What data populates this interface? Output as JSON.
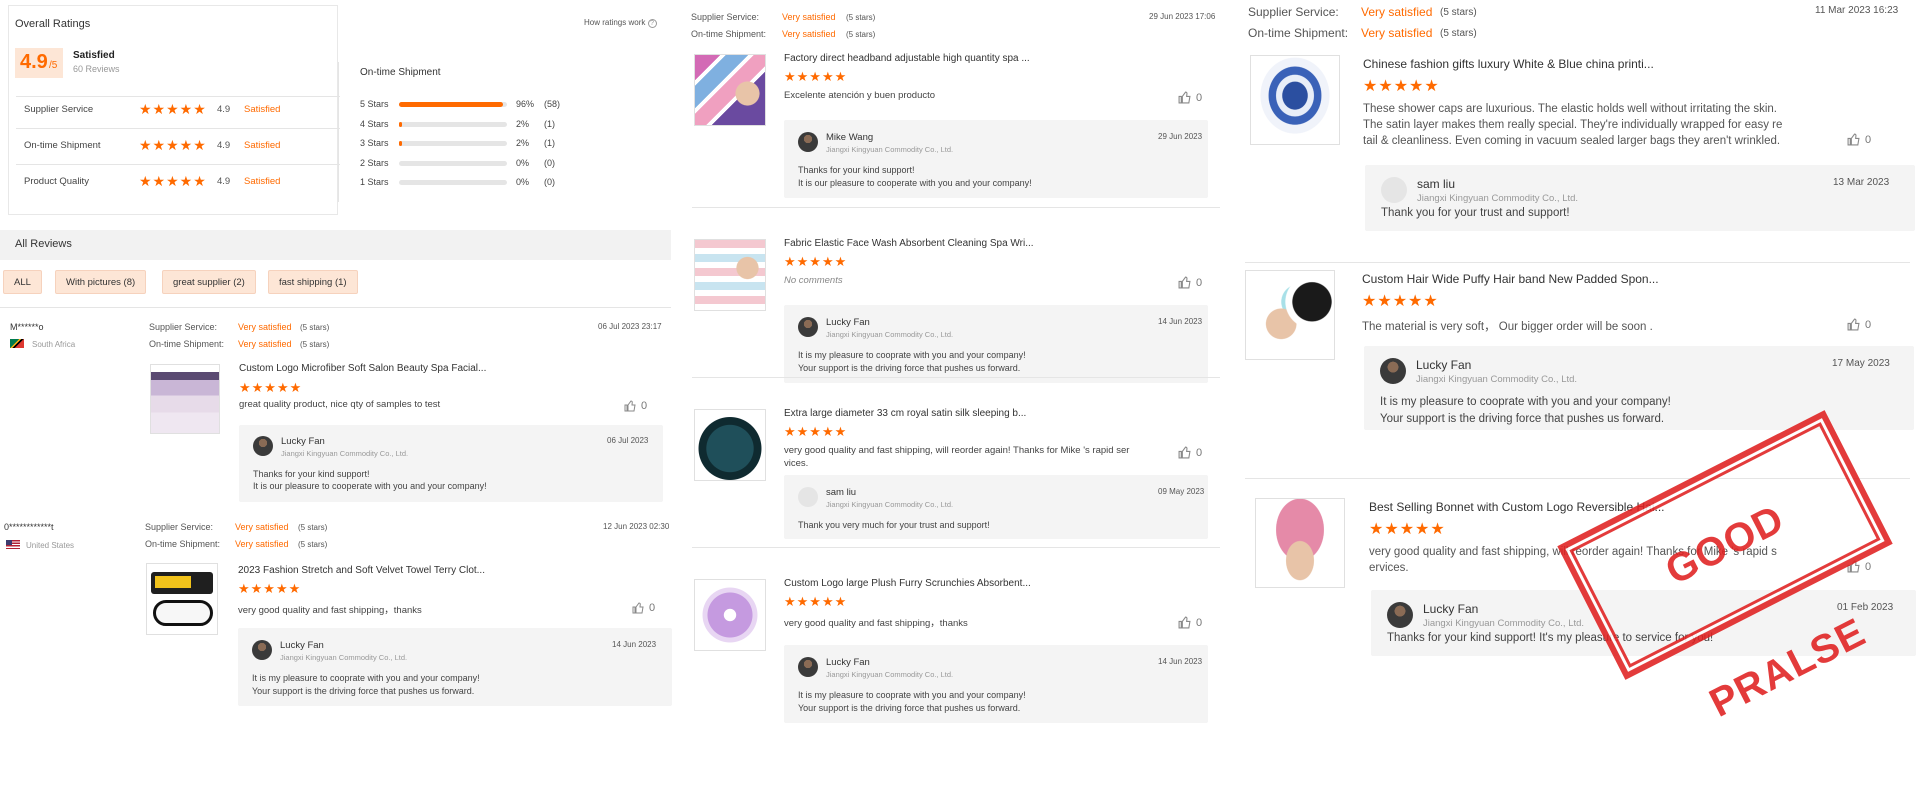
{
  "overall": {
    "header": "Overall Ratings",
    "how": "How ratings work",
    "score": "4.9",
    "out_of": "/5",
    "label": "Satisfied",
    "reviews": "60 Reviews"
  },
  "categories": [
    {
      "name": "Supplier Service",
      "score": "4.9",
      "label": "Satisfied"
    },
    {
      "name": "On-time Shipment",
      "score": "4.9",
      "label": "Satisfied"
    },
    {
      "name": "Product Quality",
      "score": "4.9",
      "label": "Satisfied"
    }
  ],
  "shipment": {
    "title": "On-time Shipment",
    "rows": [
      {
        "label": "5 Stars",
        "pct": "96%",
        "count": "(58)",
        "fill": 0.96
      },
      {
        "label": "4 Stars",
        "pct": "2%",
        "count": "(1)",
        "fill": 0.02
      },
      {
        "label": "3 Stars",
        "pct": "2%",
        "count": "(1)",
        "fill": 0.02
      },
      {
        "label": "2 Stars",
        "pct": "0%",
        "count": "(0)",
        "fill": 0
      },
      {
        "label": "1 Stars",
        "pct": "0%",
        "count": "(0)",
        "fill": 0
      }
    ]
  },
  "all_reviews": {
    "title": "All Reviews",
    "filters": [
      "ALL",
      "With pictures (8)",
      "great supplier (2)",
      "fast shipping (1)"
    ]
  },
  "labels": {
    "supplier_service": "Supplier Service:",
    "ontime": "On-time Shipment:",
    "very_satisfied": "Very satisfied",
    "five_stars": "(5 stars)",
    "stars": "★★★★★",
    "company": "Jiangxi Kingyuan Commodity Co., Ltd."
  },
  "p1": [
    {
      "user": "M******o",
      "country": "South Africa",
      "date": "06 Jul 2023 23:17",
      "product": "Custom Logo Microfiber Soft Salon Beauty Spa Facial...",
      "comment": "great quality product, nice qty of samples to test",
      "likes": "0",
      "reply_name": "Lucky Fan",
      "reply_date": "06 Jul 2023",
      "reply_lines": [
        "Thanks for your kind support!",
        "It is our pleasure to cooperate with you and your company!"
      ]
    },
    {
      "user": "0************t",
      "country": "United States",
      "date": "12 Jun 2023 02:30",
      "product": "2023 Fashion Stretch and Soft Velvet Towel Terry Clot...",
      "comment": "very good quality and fast shipping，thanks",
      "likes": "0",
      "reply_name": "Lucky Fan",
      "reply_date": "14 Jun 2023",
      "reply_lines": [
        "It is my pleasure to cooprate with you and your company!",
        "Your support is the driving force that pushes us forward."
      ]
    }
  ],
  "p2_header": {
    "date": "29 Jun 2023 17:06"
  },
  "p2": [
    {
      "product": "Factory direct headband adjustable high quantity spa ...",
      "comment": "Excelente atención y buen producto",
      "likes": "0",
      "reply_name": "Mike Wang",
      "reply_date": "29 Jun 2023",
      "reply_lines": [
        "Thanks for your kind support!",
        "It is our pleasure to cooperate with you and your company!"
      ]
    },
    {
      "product": "Fabric Elastic Face Wash Absorbent Cleaning Spa Wri...",
      "comment": "No comments",
      "likes": "0",
      "reply_name": "Lucky Fan",
      "reply_date": "14 Jun 2023",
      "reply_lines": [
        "It is my pleasure to cooprate with you and your company!",
        "Your support is the driving force that pushes us forward."
      ]
    },
    {
      "product": "Extra large diameter 33 cm royal satin silk sleeping b...",
      "comment": "very good quality and fast shipping, will reorder again! Thanks for Mike 's rapid ser",
      "comment2": "vices.",
      "likes": "0",
      "reply_name": "sam liu",
      "reply_date": "09 May 2023",
      "reply_lines": [
        "Thank you very much for your trust and support!"
      ]
    },
    {
      "product": "Custom Logo large Plush Furry Scrunchies Absorbent...",
      "comment": "very good quality and fast shipping，thanks",
      "likes": "0",
      "reply_name": "Lucky Fan",
      "reply_date": "14 Jun 2023",
      "reply_lines": [
        "It is my pleasure to cooprate with you and your company!",
        "Your support is the driving force that pushes us forward."
      ]
    }
  ],
  "p3_header": {
    "date": "11 Mar 2023 16:23"
  },
  "p3": [
    {
      "product": "Chinese fashion gifts luxury White & Blue china printi...",
      "comment_lines": [
        "These shower caps are luxurious. The elastic holds well without irritating the skin.",
        "The satin layer makes them really special. They're individually wrapped for easy re",
        "tail & cleanliness. Even coming in vacuum sealed larger bags they aren't wrinkled."
      ],
      "likes": "0",
      "reply_name": "sam liu",
      "reply_date": "13 Mar 2023",
      "reply_lines": [
        "Thank you for your trust and support!"
      ]
    },
    {
      "product": "Custom Hair Wide Puffy Hair band New Padded Spon...",
      "comment_lines": [
        "The material is very soft，  Our bigger order will be soon ."
      ],
      "likes": "0",
      "reply_name": "Lucky Fan",
      "reply_date": "17 May 2023",
      "reply_lines": [
        "It is my pleasure to cooprate with you and your company!",
        "Your support is the driving force that pushes us forward."
      ]
    },
    {
      "product": "Best Selling Bonnet with Custom Logo Reversible Hai...",
      "comment_lines": [
        "very good quality and fast shipping, will reorder again! Thanks for Mike 's rapid s",
        "ervices."
      ],
      "likes": "0",
      "reply_name": "Lucky Fan",
      "reply_date": "01 Feb 2023",
      "reply_lines": [
        "Thanks for your kind support! It's my pleasure to service for you!"
      ]
    }
  ],
  "stamp": "GOOD PRALSE",
  "colors": {
    "accent": "#ff6a00",
    "stamp": "#e02020"
  }
}
